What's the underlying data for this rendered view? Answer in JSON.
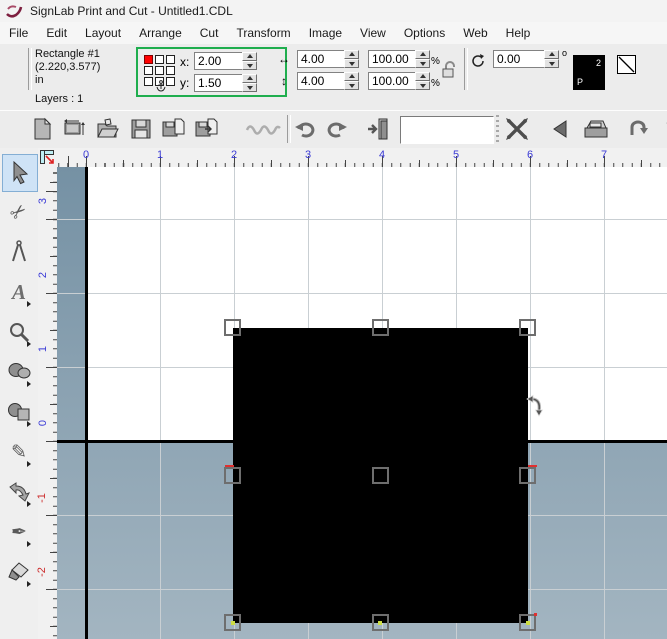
{
  "window": {
    "title": "SignLab Print and Cut - Untitled1.CDL",
    "app_icon": "signlab-logo"
  },
  "menu_bar": {
    "items": [
      "File",
      "Edit",
      "Layout",
      "Arrange",
      "Cut",
      "Transform",
      "Image",
      "View",
      "Options",
      "Web",
      "Help"
    ]
  },
  "property_bar": {
    "object_name": "Rectangle #1",
    "object_coords": "(2.220,3.577)",
    "units": "in",
    "layers_label": "Layers : 1",
    "x_label": "x:",
    "x_value": "2.00",
    "y_label": "y:",
    "y_value": "1.50",
    "width_value": "4.00",
    "height_value": "4.00",
    "width_percent": "100.00",
    "height_percent": "100.00",
    "percent_symbol": "%",
    "rotation_value": "0.00",
    "degree_symbol": "o",
    "highlight_color": "#1fae4e",
    "fill_swatch": {
      "layer_count": "2",
      "mode_letter": "P"
    }
  },
  "toolbar": {
    "icon_names": [
      "new-document",
      "page-setup",
      "open-folder",
      "save",
      "import",
      "export",
      "grayed-tool",
      "undo",
      "redo",
      "exit-door",
      "preview-box",
      "cut-x",
      "pointer-left",
      "print",
      "plot-rotate"
    ]
  },
  "tool_palette": {
    "selected": "select-arrow",
    "tools": [
      "select-arrow",
      "scissors",
      "compass",
      "text",
      "zoom",
      "shape-balloons",
      "shape-circle-square",
      "pencil",
      "node-edit",
      "pen-nib",
      "knife"
    ]
  },
  "rulers": {
    "unit": "in",
    "horizontal_labels": [
      "0",
      "1",
      "2",
      "3",
      "4",
      "5",
      "6",
      "7"
    ],
    "vertical_labels": [
      "3",
      "2",
      "1",
      "0",
      "-1",
      "-2"
    ],
    "positive_color": "#3b3bd6",
    "negative_color": "#cc2a2a"
  },
  "canvas": {
    "selected_object": {
      "type": "rectangle",
      "fill": "#000000",
      "x_in": "2.00",
      "y_in": "1.50",
      "width_in": "4.00",
      "height_in": "4.00"
    },
    "pasteboard_color": "#7f99ab",
    "page_color": "#ffffff",
    "grid_color": "#c9cfd3"
  }
}
